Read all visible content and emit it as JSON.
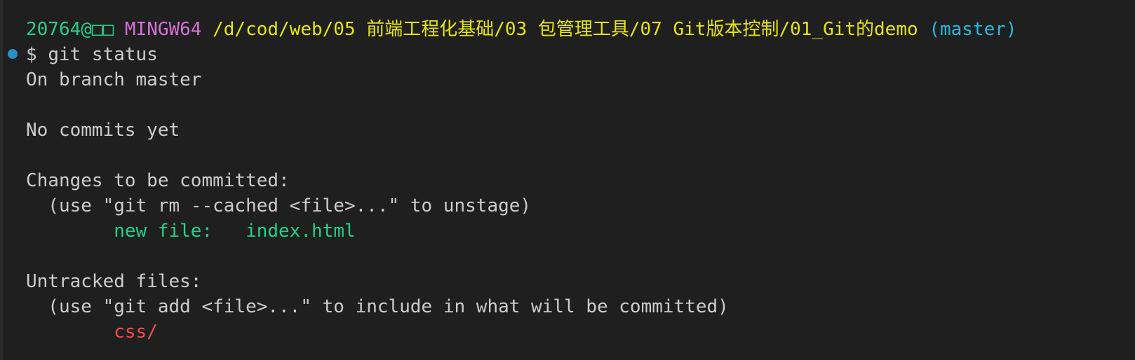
{
  "prompt": {
    "user_host": "20764@□□",
    "shell": "MINGW64",
    "path": "/d/cod/web/05 前端工程化基础/03 包管理工具/07 Git版本控制/01_Git的demo",
    "branch": "(master)"
  },
  "command": {
    "symbol": "$",
    "text": "git status"
  },
  "output": {
    "branch_line": "On branch master",
    "no_commits": "No commits yet",
    "staged_header": "Changes to be committed:",
    "staged_hint": "  (use \"git rm --cached <file>...\" to unstage)",
    "staged_files": [
      {
        "status": "new file:",
        "name": "index.html"
      }
    ],
    "untracked_header": "Untracked files:",
    "untracked_hint": "  (use \"git add <file>...\" to include in what will be committed)",
    "untracked_files": [
      "css/"
    ]
  },
  "colors": {
    "background": "#1f1f1f",
    "foreground": "#cccccc",
    "prompt_user": "#23d18b",
    "prompt_shell": "#d670d6",
    "prompt_path": "#e5e510",
    "prompt_branch": "#29b8db",
    "staged_file": "#23d18b",
    "untracked_file": "#f14c4c",
    "command_decoration": "#2a8fc4"
  },
  "icons": {
    "command_decoration": "command-decoration-dot-icon"
  }
}
